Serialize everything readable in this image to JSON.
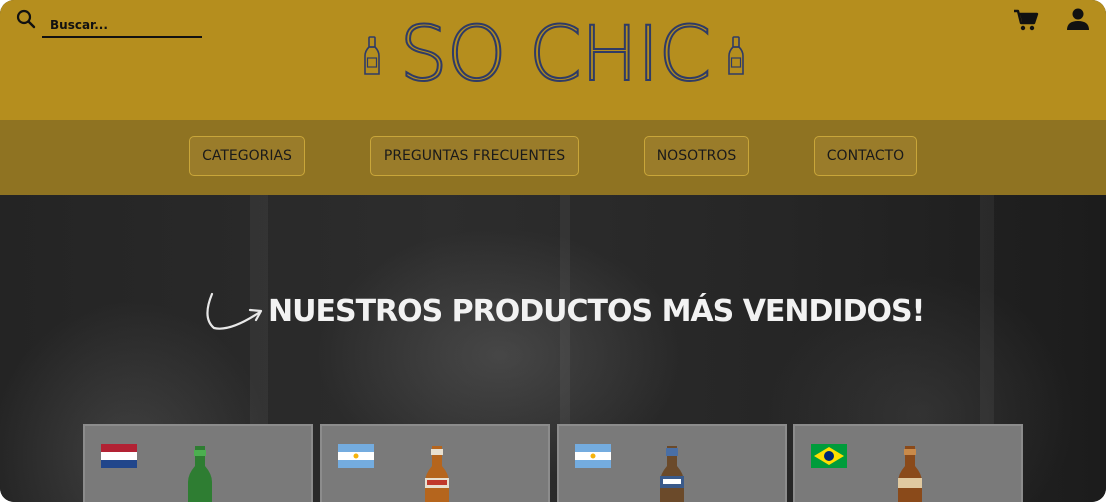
{
  "header": {
    "logo_text": "SO CHIC",
    "search": {
      "placeholder": "Buscar...",
      "value": ""
    }
  },
  "nav": {
    "items": [
      {
        "label": "CATEGORIAS"
      },
      {
        "label": "PREGUNTAS FRECUENTES"
      },
      {
        "label": "NOSOTROS"
      },
      {
        "label": "CONTACTO"
      }
    ]
  },
  "hero": {
    "title": "NUESTROS PRODUCTOS MÁS VENDIDOS!"
  },
  "products": [
    {
      "flag": "netherlands-flag",
      "bottle_color": "#2e7d32"
    },
    {
      "flag": "argentina-flag",
      "bottle_color": "#b5651d"
    },
    {
      "flag": "argentina-flag",
      "bottle_color": "#3a5a8a"
    },
    {
      "flag": "brazil-flag",
      "bottle_color": "#8a4a1a"
    }
  ],
  "colors": {
    "header_bg": "#b58e1e",
    "nav_bg": "#8f7322",
    "logo_outline": "#2f3b66",
    "hero_text": "#f2f2f2"
  }
}
